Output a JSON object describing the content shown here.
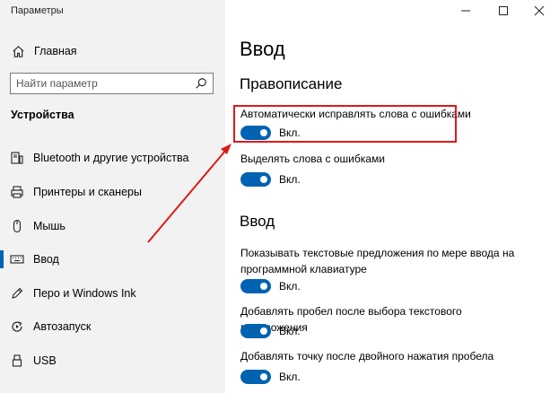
{
  "window": {
    "title": "Параметры"
  },
  "sidebar": {
    "home_label": "Главная",
    "search_placeholder": "Найти параметр",
    "section_label": "Устройства",
    "items": [
      {
        "label": "Bluetooth и другие устройства",
        "icon": "bluetooth-devices-icon"
      },
      {
        "label": "Принтеры и сканеры",
        "icon": "printer-icon"
      },
      {
        "label": "Мышь",
        "icon": "mouse-icon"
      },
      {
        "label": "Ввод",
        "icon": "keyboard-icon",
        "active": true
      },
      {
        "label": "Перо и Windows Ink",
        "icon": "pen-icon"
      },
      {
        "label": "Автозапуск",
        "icon": "autoplay-icon"
      },
      {
        "label": "USB",
        "icon": "usb-icon"
      }
    ]
  },
  "main": {
    "title": "Ввод",
    "spelling": {
      "heading": "Правописание",
      "settings": [
        {
          "label": "Автоматически исправлять слова с ошибками",
          "state": "Вкл.",
          "on": true
        },
        {
          "label": "Выделять слова с ошибками",
          "state": "Вкл.",
          "on": true
        }
      ]
    },
    "typing": {
      "heading": "Ввод",
      "settings": [
        {
          "label": "Показывать текстовые предложения по мере ввода на программной клавиатуре",
          "state": "Вкл.",
          "on": true
        },
        {
          "label": "Добавлять пробел после выбора текстового предложения",
          "state": "Вкл.",
          "on": true
        },
        {
          "label": "Добавлять точку после двойного нажатия пробела",
          "state": "Вкл.",
          "on": true
        }
      ]
    }
  },
  "colors": {
    "accent": "#0063b1",
    "annotation": "#e01818",
    "sidebar_bg": "#f2f2f2"
  }
}
